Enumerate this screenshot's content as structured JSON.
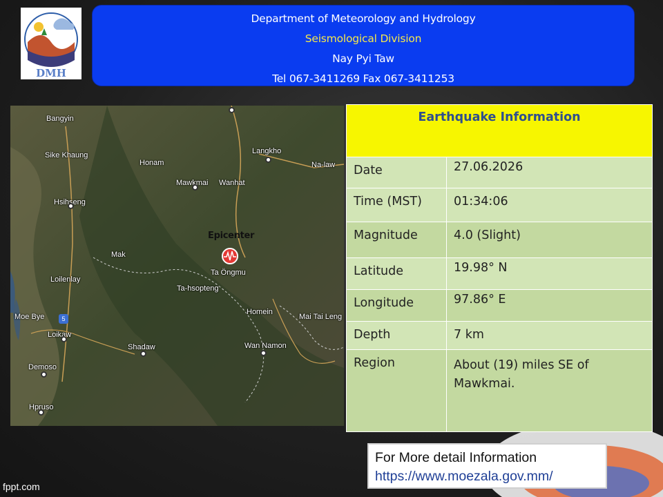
{
  "logo": {
    "text": "DMH",
    "icon": "dmh-logo-icon"
  },
  "header": {
    "line1": "Department of Meteorology and Hydrology",
    "line2": "Seismological Division",
    "line3": "Nay Pyi Taw",
    "line4": "Tel 067-3411269 Fax 067-3411253"
  },
  "map": {
    "epicenter_label": "Epicenter",
    "epicenter_icon": "seismic-marker-icon",
    "places": [
      {
        "name": "Bangyin"
      },
      {
        "name": "Sike Khaung"
      },
      {
        "name": "Honam"
      },
      {
        "name": "Langkho"
      },
      {
        "name": "Na-law"
      },
      {
        "name": "Mawkmai"
      },
      {
        "name": "Wanhat"
      },
      {
        "name": "Hsihseng"
      },
      {
        "name": "Mak"
      },
      {
        "name": "Ta Öngmu"
      },
      {
        "name": "Loilenlay"
      },
      {
        "name": "Ta-hsopteng"
      },
      {
        "name": "Moe Bye"
      },
      {
        "name": "Homein"
      },
      {
        "name": "Mai Tai Leng"
      },
      {
        "name": "Loikaw"
      },
      {
        "name": "Shadaw"
      },
      {
        "name": "Wan Namon"
      },
      {
        "name": "Demoso"
      },
      {
        "name": "Hpruso"
      }
    ],
    "route_badge": "5"
  },
  "info": {
    "title": "Earthquake Information",
    "rows": [
      {
        "key": "Date",
        "value": "27.06.2026"
      },
      {
        "key": "Time (MST)",
        "value": "01:34:06"
      },
      {
        "key": "Magnitude",
        "value": "4.0 (Slight)"
      },
      {
        "key": "Latitude",
        "value": "19.98° N"
      },
      {
        "key": "Longitude",
        "value": "97.86° E"
      },
      {
        "key": "Depth",
        "value": "7 km"
      },
      {
        "key": "Region",
        "value": "About (19) miles SE of Mawkmai."
      }
    ]
  },
  "more": {
    "text": "For More detail Information",
    "url": "https://www.moezala.gov.mm/"
  },
  "footer": {
    "brand": "fppt.com"
  }
}
